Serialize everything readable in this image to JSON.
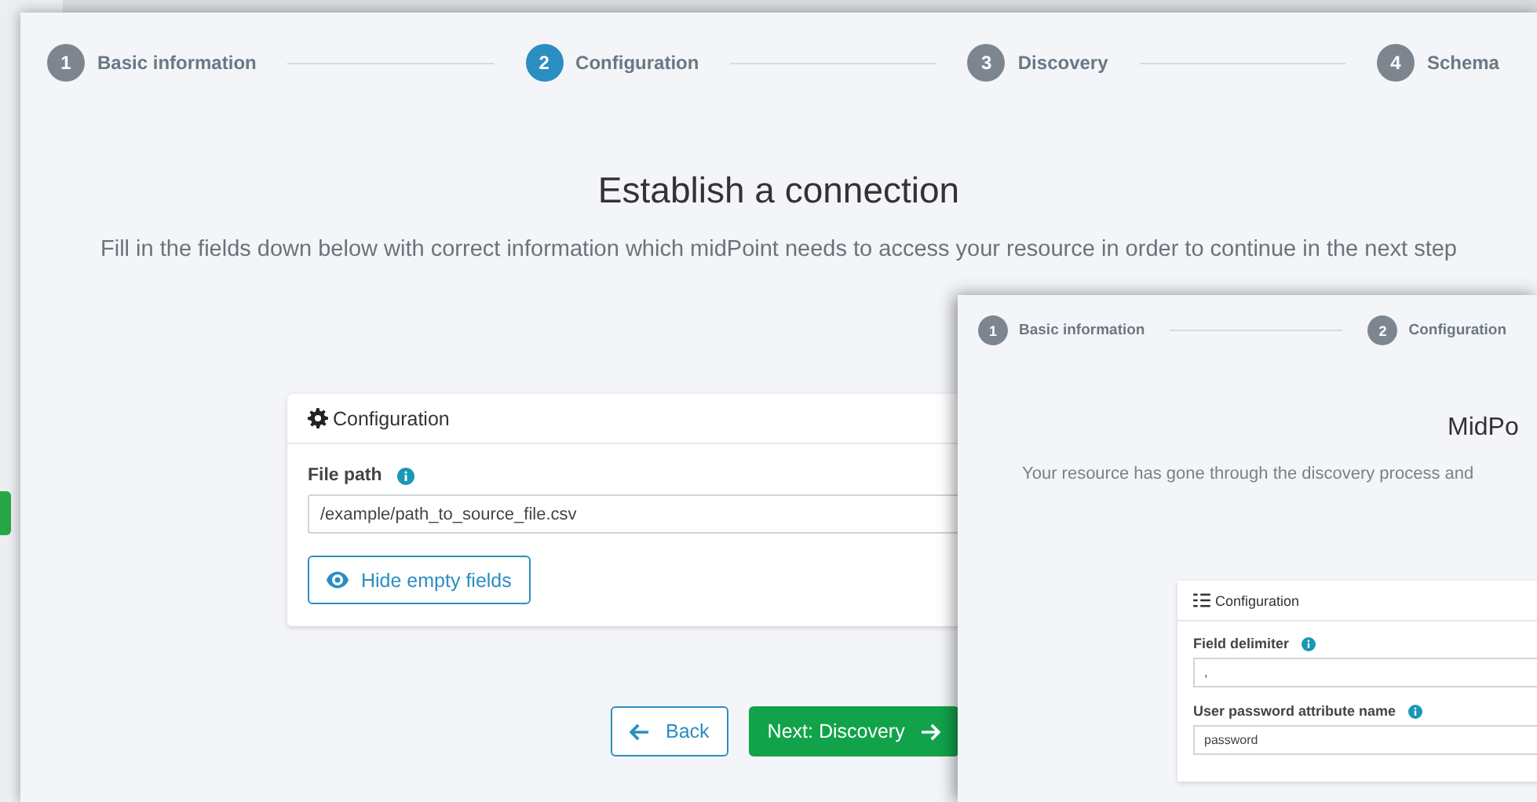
{
  "main_window": {
    "steps": [
      {
        "number": "1",
        "label": "Basic information",
        "selected": false
      },
      {
        "number": "2",
        "label": "Configuration",
        "selected": true
      },
      {
        "number": "3",
        "label": "Discovery",
        "selected": false
      },
      {
        "number": "4",
        "label": "Schema",
        "selected": false
      }
    ],
    "title": "Establish a connection",
    "subtitle": "Fill in the fields down below with correct information which midPoint needs to access your resource in order to continue in the next step",
    "card": {
      "title": "Configuration",
      "fields": [
        {
          "label": "File path",
          "value": "/example/path_to_source_file.csv"
        }
      ],
      "toggle_button": "Hide empty fields"
    },
    "buttons": [
      {
        "kind": "back",
        "label": "Back"
      },
      {
        "kind": "next",
        "label": "Next: Discovery"
      }
    ]
  },
  "second_window": {
    "steps": [
      {
        "number": "1",
        "label": "Basic information",
        "selected": false
      },
      {
        "number": "2",
        "label": "Configuration",
        "selected": false
      }
    ],
    "title": "MidPo",
    "subtitle": "Your resource has gone through the discovery process and",
    "card": {
      "title": "Configuration",
      "fields": [
        {
          "label": "Field delimiter",
          "value": ","
        },
        {
          "label": "User password attribute name",
          "value": "password"
        }
      ]
    }
  }
}
